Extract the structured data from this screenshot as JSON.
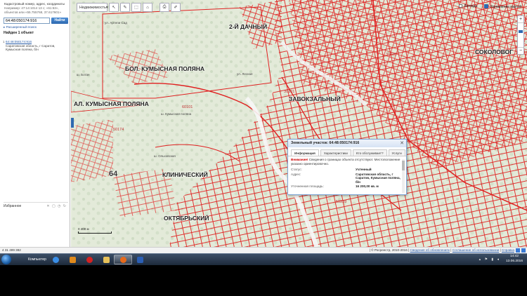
{
  "left_panel": {
    "hint_title": "Кадастровый номер, адрес, координаты",
    "hint_example1": "Например: 47:14:1014 13 с; «61:63»,",
    "hint_example2": "объектов или «55.755768, 37.617601»",
    "search_value": "64:48:050174:916",
    "search_button": "Найти",
    "advanced_link": "▸ Расширенный поиск",
    "found_label": "Найден 1 объект",
    "result": {
      "index": "1",
      "id": "64:48:050174:916",
      "address": "Саратовская область, г Саратов, Кумысная поляна, б/н"
    },
    "favorites_label": "Избранное",
    "favorites_icons": "✕ ▢ ◷ ↻"
  },
  "toolbar": {
    "dropdown_label": "Недвижимость",
    "dropdown_arrow": "▾",
    "icons": [
      "pointer-icon",
      "ruler-icon",
      "select-icon",
      "building-icon",
      "print-icon",
      "measure-icon"
    ],
    "icon_glyphs": [
      "↖",
      "✎",
      "⬚",
      "⌂",
      "⎙",
      "✐"
    ],
    "legend_label": "Легенда",
    "layers_label": "Управление картой"
  },
  "zoom": {
    "plus": "+",
    "minus": "−"
  },
  "map_labels": {
    "d1": "2-Й ДАЧНЫЙ",
    "d2": "БОЛ. КУМЫСНАЯ ПОЛЯНА",
    "d3": "АЛ. КУМЫСНАЯ ПОЛЯНА",
    "d4": "ЗАВОКЗАЛЬНЫЙ",
    "d5": "СОКОЛОВОГ",
    "d6": "КЛИНИЧЕСКИЙ",
    "d7": "ОКТЯБРЬСКИЙ",
    "q1": "60101",
    "q2": "50174",
    "q3": "30101",
    "q4": "30228",
    "q5": "50228",
    "q6": "64",
    "q7": "30207",
    "s1": "ул. Артели Сад",
    "s2": "ш. Ботан",
    "s3": "ул. Лесная",
    "s4": "ш. Кумысная поляна",
    "s5": "ш. Ольховская"
  },
  "scale": {
    "label": "0 400 м"
  },
  "popup": {
    "title": "Земельный участок: 64:48:050174:916",
    "close": "✕",
    "tabs": [
      "Информация",
      "Характеристики",
      "Кто обслуживает?",
      "Услуги"
    ],
    "warning_label": "Внимание!",
    "warning_text": "Сведения о границах объекта отсутствуют. Местоположение указано ориентировочно.",
    "rows": [
      {
        "k": "Статус:",
        "v": "Учтенный"
      },
      {
        "k": "Адрес:",
        "v": "Саратовская область, г Саратов, Кумысная поляна, б/н"
      },
      {
        "k": "Уточненная площадь:",
        "v": "16 200,00 кв. м"
      }
    ]
  },
  "status_bar": {
    "coords": "4 31 499 382",
    "copyright": "| © Росреестр, 2010-2016 |",
    "link1": "Сведения об обновлениях",
    "link2": "Соглашение об использовании",
    "link3": "Справка",
    "sep": "|"
  },
  "taskbar": {
    "computer_label": "Компьютер",
    "time": "14:42",
    "date": "13.06.2016",
    "tray_icons": "▴ ⚑ ▮ ◂",
    "apps": [
      {
        "name": "ie",
        "color": "#3a8ee6",
        "active": false
      },
      {
        "name": "media",
        "color": "#e08a1c",
        "active": false
      },
      {
        "name": "opera",
        "color": "#d42222",
        "active": false
      },
      {
        "name": "explorer",
        "color": "#e6c15a",
        "active": false
      },
      {
        "name": "firefox",
        "color": "#e66a1c",
        "active": true
      },
      {
        "name": "word",
        "color": "#2b5fb5",
        "active": false
      }
    ]
  },
  "colors": {
    "parcel_line": "#e02020",
    "map_bg": "#e9eee4",
    "accent": "#2e69b0"
  }
}
